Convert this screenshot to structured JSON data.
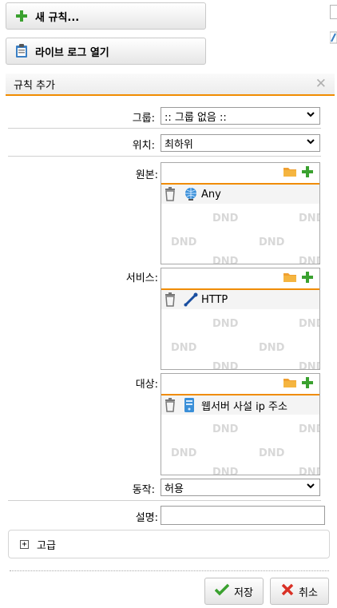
{
  "toolbar": {
    "new_rule_label": "새 규칙...",
    "live_log_label": "라이브 로그 열기"
  },
  "dialog": {
    "title": "규칙 추가",
    "group": {
      "label": "그룹:",
      "value": ":: 그룹 없음 ::"
    },
    "position": {
      "label": "위치:",
      "value": "최하위"
    },
    "source": {
      "label": "원본:",
      "items": [
        "Any"
      ]
    },
    "service": {
      "label": "서비스:",
      "items": [
        "HTTP"
      ]
    },
    "destination": {
      "label": "대상:",
      "items": [
        "웹서버 사설 ip 주소"
      ]
    },
    "action": {
      "label": "동작:",
      "value": "허용"
    },
    "description": {
      "label": "설명:",
      "value": ""
    },
    "advanced_label": "고급",
    "dnd_text": "DND",
    "save_label": "저장",
    "cancel_label": "취소"
  },
  "colors": {
    "accent_orange": "#f08c00",
    "add_green": "#3aa12f",
    "cancel_red": "#d93025",
    "folder_orange": "#f0a030"
  },
  "icons": [
    "plus-icon",
    "clipboard-log-icon",
    "close-icon",
    "folder-icon",
    "trash-icon",
    "network-globe-icon",
    "service-icon",
    "server-icon",
    "checkmark-icon",
    "x-icon"
  ]
}
